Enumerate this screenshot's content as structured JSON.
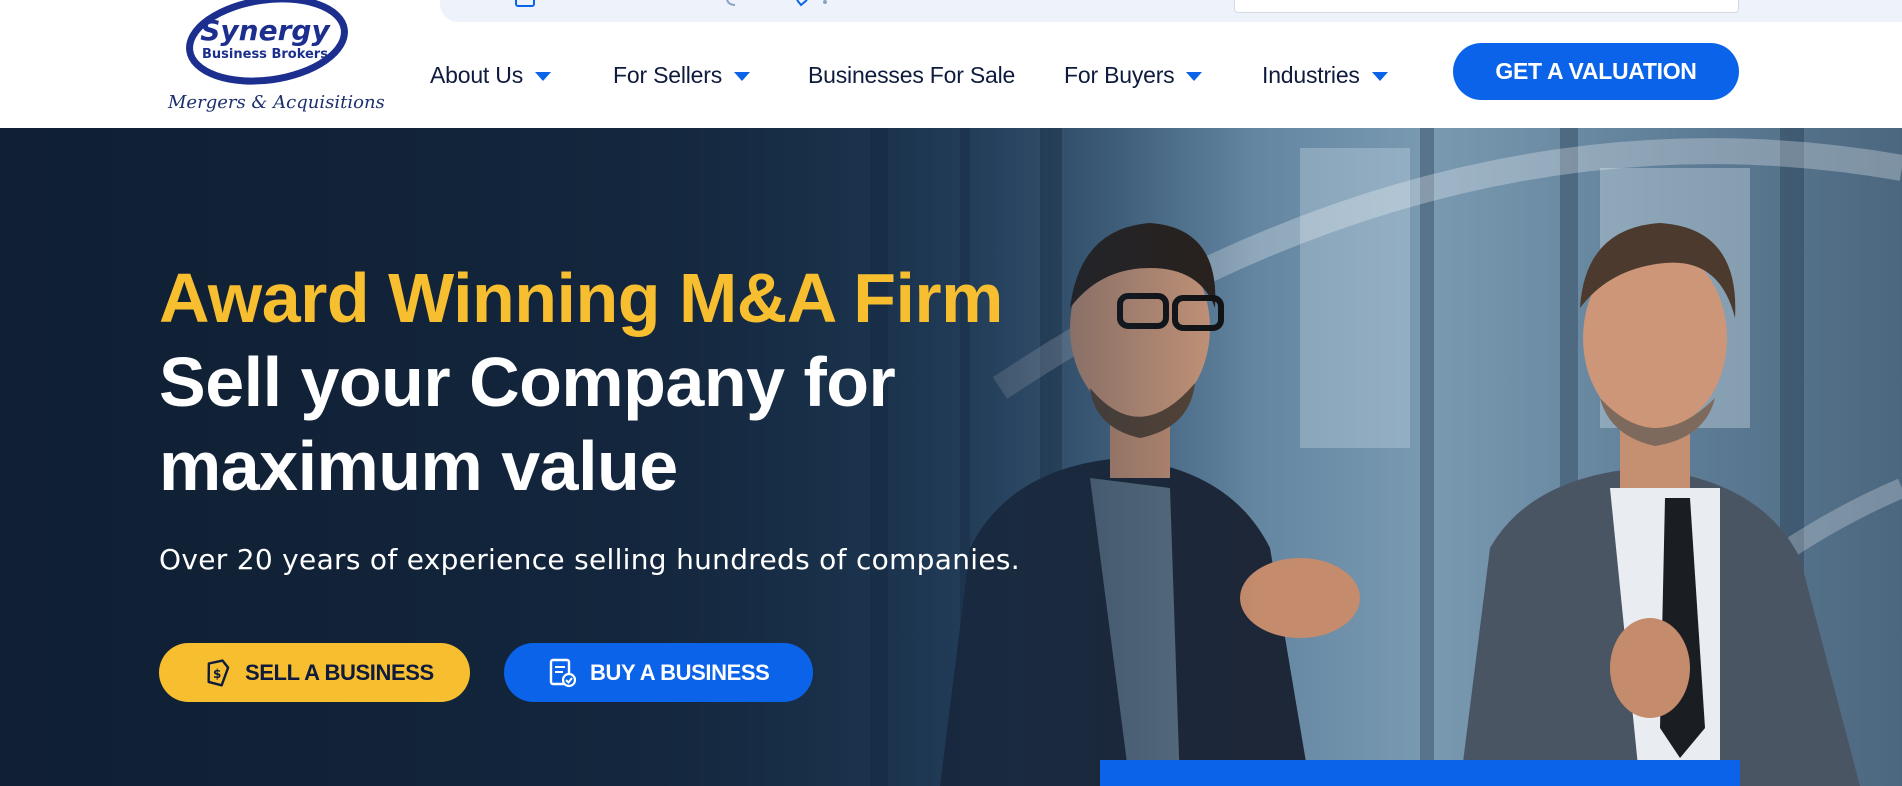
{
  "logo": {
    "name_line1": "Synergy",
    "name_line2": "Business Brokers",
    "tagline": "Mergers & Acquisitions"
  },
  "nav": {
    "items": [
      {
        "label": "About Us",
        "has_dropdown": true
      },
      {
        "label": "For Sellers",
        "has_dropdown": true
      },
      {
        "label": "Businesses For Sale",
        "has_dropdown": false
      },
      {
        "label": "For Buyers",
        "has_dropdown": true
      },
      {
        "label": "Industries",
        "has_dropdown": true
      }
    ],
    "cta_label": "GET A VALUATION"
  },
  "hero": {
    "title_highlight": "Award Winning M&A Firm",
    "title_main": "Sell your Company for maximum value",
    "subtitle": "Over 20 years of experience selling hundreds of companies.",
    "buttons": {
      "sell_label": "SELL A BUSINESS",
      "buy_label": "BUY A BUSINESS"
    }
  },
  "colors": {
    "accent_blue": "#0a63e8",
    "accent_yellow": "#f7be2f",
    "nav_text": "#0f1b3d",
    "hero_dark": "#15293f"
  },
  "icons": {
    "sell_button_icon": "dollar-tag-icon",
    "buy_button_icon": "document-check-icon",
    "topbar_icons": [
      "calendar-icon",
      "phone-icon",
      "location-icon"
    ]
  }
}
